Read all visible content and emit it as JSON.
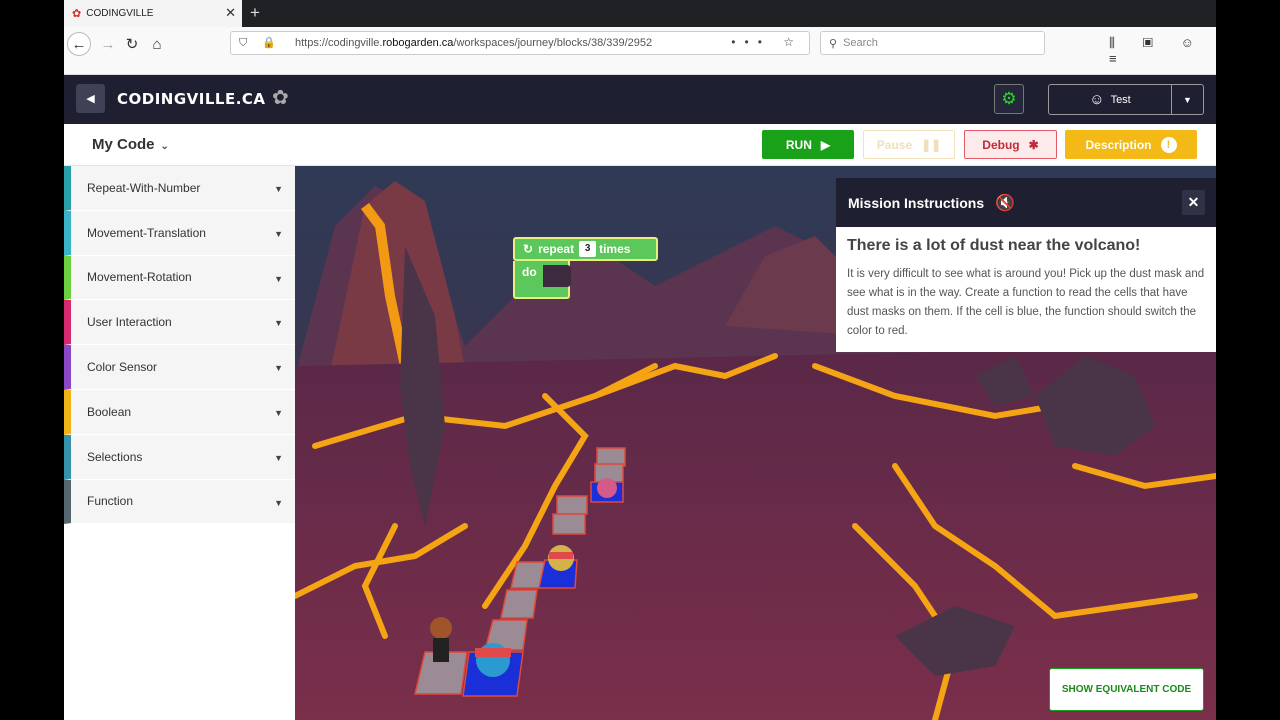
{
  "browser": {
    "tab_title": "CODINGVILLE",
    "url_prefix": "https://codingville.",
    "url_host": "robogarden.ca",
    "url_path": "/workspaces/journey/blocks/38/339/2952",
    "search_placeholder": "Search"
  },
  "header": {
    "brand": "CODINGVILLE.CA",
    "user_label": "Test"
  },
  "actions": {
    "my_code": "My Code",
    "run": "RUN",
    "pause": "Pause",
    "debug": "Debug",
    "description": "Description"
  },
  "sidebar": {
    "categories": [
      {
        "label": "Repeat-With-Number",
        "color": "#2aa0a8"
      },
      {
        "label": "Movement-Translation",
        "color": "#3ab3c9"
      },
      {
        "label": "Movement-Rotation",
        "color": "#6ccf3f"
      },
      {
        "label": "User Interaction",
        "color": "#d62a70"
      },
      {
        "label": "Color Sensor",
        "color": "#8a48c6"
      },
      {
        "label": "Boolean",
        "color": "#f0b419"
      },
      {
        "label": "Selections",
        "color": "#3592a8"
      },
      {
        "label": "Function",
        "color": "#55666e"
      }
    ]
  },
  "block": {
    "repeat": "repeat",
    "count": "3",
    "times": "times",
    "do": "do"
  },
  "mission": {
    "header": "Mission Instructions",
    "title": "There is a lot of dust near the volcano!",
    "text": "It is very difficult to see what is around you! Pick up the dust mask and see what is in the way. Create a function to read the cells that have dust masks on them. If the cell is blue, the function should switch the color to red."
  },
  "equivalent_button": "SHOW EQUIVALENT CODE"
}
